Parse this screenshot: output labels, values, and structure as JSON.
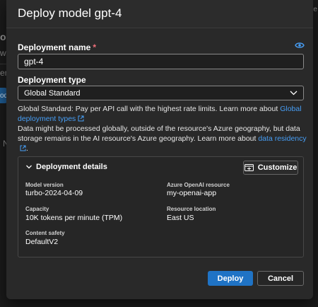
{
  "background": {
    "fragments": [
      "ol",
      "wit",
      "ent",
      "ode",
      "N",
      "re"
    ]
  },
  "dialog": {
    "title": "Deploy model gpt-4",
    "deployment_name": {
      "label": "Deployment name",
      "required_mark": "*",
      "value": "gpt-4"
    },
    "deployment_type": {
      "label": "Deployment type",
      "selected": "Global Standard"
    },
    "description": {
      "line1_text": "Global Standard: Pay per API call with the highest rate limits. Learn more about ",
      "line1_link": "Global deployment types",
      "line2_text": "Data might be processed globally, outside of the resource's Azure geography, but data storage remains in the AI resource's Azure geography. Learn more about ",
      "line2_link": "data residency",
      "line2_end": "."
    },
    "details": {
      "title": "Deployment details",
      "customize_label": "Customize",
      "model_version_label": "Model version",
      "model_version_value": "turbo-2024-04-09",
      "resource_label": "Azure OpenAI resource",
      "resource_value": "my-openai-app",
      "capacity_label": "Capacity",
      "capacity_value": "10K tokens per minute (TPM)",
      "location_label": "Resource location",
      "location_value": "East US",
      "safety_label": "Content safety",
      "safety_value": "DefaultV2"
    },
    "buttons": {
      "deploy": "Deploy",
      "cancel": "Cancel"
    }
  },
  "colors": {
    "accent": "#1f73c5",
    "link": "#479ef5",
    "required": "#f1707b",
    "dialog_bg": "#292929"
  }
}
